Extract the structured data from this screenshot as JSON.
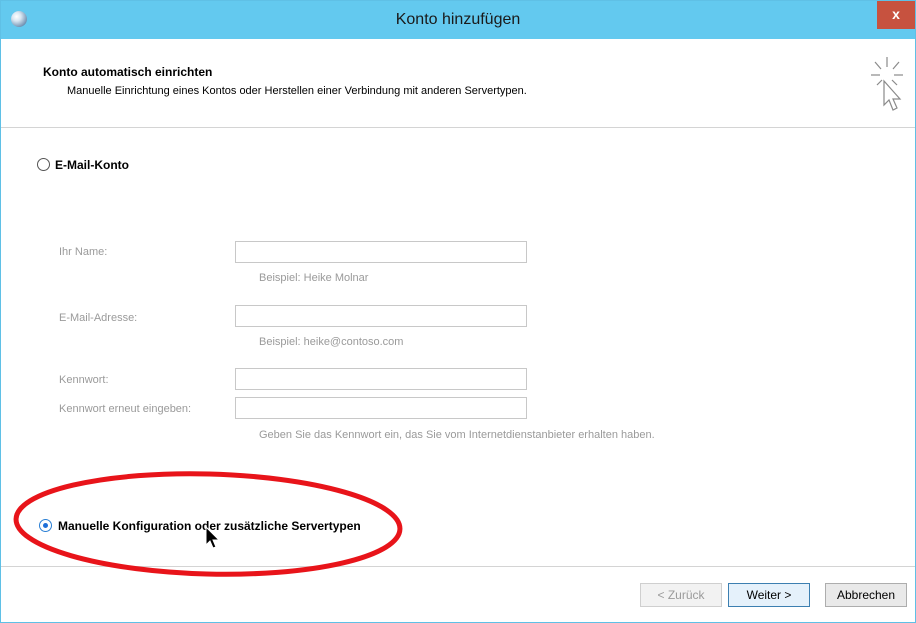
{
  "window": {
    "title": "Konto hinzufügen",
    "close_label": "x"
  },
  "header": {
    "title": "Konto automatisch einrichten",
    "subtitle": "Manuelle Einrichtung eines Kontos oder Herstellen einer Verbindung mit anderen Servertypen."
  },
  "options": {
    "email_account": {
      "label": "E-Mail-Konto",
      "selected": false
    },
    "manual_config": {
      "label": "Manuelle Konfiguration oder zusätzliche Servertypen",
      "selected": true
    }
  },
  "form": {
    "name_label": "Ihr Name:",
    "name_value": "",
    "name_hint": "Beispiel: Heike Molnar",
    "email_label": "E-Mail-Adresse:",
    "email_value": "",
    "email_hint": "Beispiel: heike@contoso.com",
    "password_label": "Kennwort:",
    "password_value": "",
    "password_confirm_label": "Kennwort erneut eingeben:",
    "password_confirm_value": "",
    "password_hint": "Geben Sie das Kennwort ein, das Sie vom Internetdienstanbieter erhalten haben."
  },
  "buttons": {
    "back": "< Zurück",
    "next": "Weiter >",
    "cancel": "Abbrechen"
  },
  "colors": {
    "titlebar": "#63c9ef",
    "close_button": "#c7523f",
    "annotation_ellipse": "#e8141a",
    "radio_selected": "#1e6fd8"
  }
}
